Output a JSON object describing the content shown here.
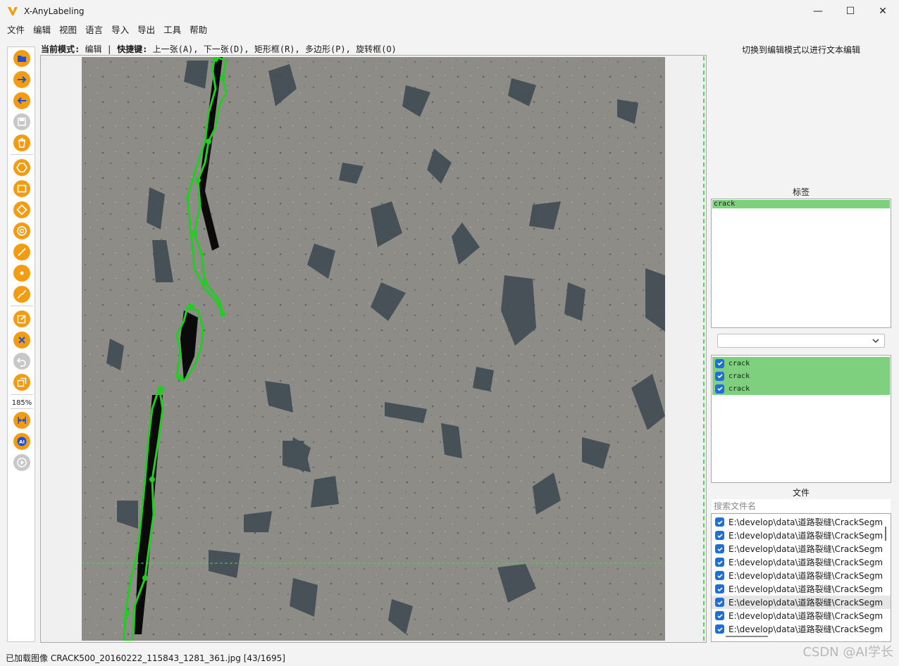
{
  "window": {
    "title": "X-AnyLabeling",
    "minimize_glyph": "—",
    "maximize_glyph": "☐",
    "close_glyph": "✕"
  },
  "menu": [
    "文件",
    "编辑",
    "视图",
    "语言",
    "导入",
    "导出",
    "工具",
    "帮助"
  ],
  "toolbar": {
    "tools": [
      {
        "icon": "open-folder-icon",
        "style": "orange"
      },
      {
        "icon": "next-image-icon",
        "style": "orange"
      },
      {
        "icon": "prev-image-icon",
        "style": "orange"
      },
      {
        "icon": "save-icon",
        "style": "gray"
      },
      {
        "icon": "delete-file-icon",
        "style": "orange"
      },
      {
        "icon": "polygon-icon",
        "style": "orange"
      },
      {
        "icon": "rectangle-icon",
        "style": "orange"
      },
      {
        "icon": "rotation-icon",
        "style": "orange"
      },
      {
        "icon": "circle-icon",
        "style": "orange"
      },
      {
        "icon": "line-icon",
        "style": "orange"
      },
      {
        "icon": "point-icon",
        "style": "orange"
      },
      {
        "icon": "linestrip-icon",
        "style": "orange"
      },
      {
        "icon": "edit-icon",
        "style": "orange"
      },
      {
        "icon": "delete-shape-icon",
        "style": "orange"
      },
      {
        "icon": "undo-icon",
        "style": "gray"
      },
      {
        "icon": "duplicate-icon",
        "style": "orange"
      },
      {
        "icon": "fit-width-icon",
        "style": "orange"
      },
      {
        "icon": "ai-icon",
        "style": "orange"
      },
      {
        "icon": "run-icon",
        "style": "gray"
      }
    ],
    "zoom": "185%"
  },
  "mode": {
    "label": "当前模式:",
    "value": " 编辑 | ",
    "shortcut_label": "快捷键:",
    "shortcuts": " 上一张(A), 下一张(D), 矩形框(R), 多边形(P), 旋转框(O)"
  },
  "right": {
    "hint": "切换到编辑模式以进行文本编辑",
    "labels_title": "标签",
    "labels": [
      "crack"
    ],
    "shapes": [
      "crack",
      "crack",
      "crack"
    ],
    "files_title": "文件",
    "search_placeholder": "搜索文件名",
    "files": [
      "E:\\develop\\data\\道路裂缝\\CrackSegm",
      "E:\\develop\\data\\道路裂缝\\CrackSegm",
      "E:\\develop\\data\\道路裂缝\\CrackSegm",
      "E:\\develop\\data\\道路裂缝\\CrackSegm",
      "E:\\develop\\data\\道路裂缝\\CrackSegm",
      "E:\\develop\\data\\道路裂缝\\CrackSegm",
      "E:\\develop\\data\\道路裂缝\\CrackSegm",
      "E:\\develop\\data\\道路裂缝\\CrackSegm",
      "E:\\develop\\data\\道路裂缝\\CrackSegm"
    ],
    "selected_file_index": 6
  },
  "status": "已加载图像 CRACK500_20160222_115843_1281_361.jpg [43/1695]",
  "watermark": "CSDN @AI学长",
  "colors": {
    "accent": "#f39c12",
    "label_bg": "#7ed07e",
    "annotation": "#22cc22",
    "checkbox": "#1f6fd6"
  }
}
